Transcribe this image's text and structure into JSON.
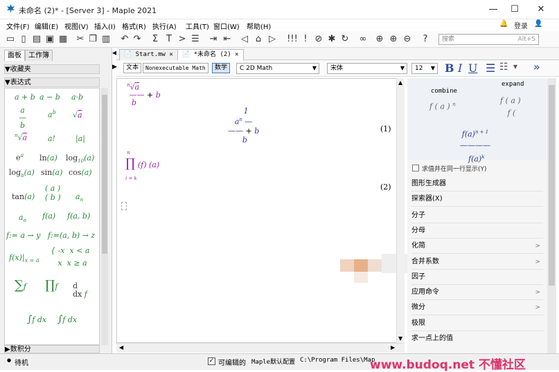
{
  "window": {
    "title": "未命名 (2)* - [Server 3] - Maple 2021",
    "minimize": "—",
    "maximize": "☐",
    "close": "✕"
  },
  "menu": {
    "items": [
      "文件(F)",
      "编辑(E)",
      "视图(V)",
      "插入(I)",
      "格式(R)",
      "执行(A)",
      "工具(T)",
      "窗口(W)",
      "帮助(H)"
    ],
    "login": "登录"
  },
  "search": {
    "placeholder": "搜索",
    "shortcut": "Alt+S"
  },
  "left_panel": {
    "tabs": [
      "面板",
      "工作簿"
    ],
    "favorites": "收藏夹",
    "expressions": "表达式",
    "bottom_section": "数积分"
  },
  "doc_tabs": [
    {
      "label": "Start.mw"
    },
    {
      "label": "*未命名 (2)"
    }
  ],
  "format_bar": {
    "text_btn": "文本",
    "nonexec_btn": "Nonexecutable Math",
    "math_btn": "数学",
    "style_select": "C 2D Math",
    "font_select": "宋体",
    "size_select": "12"
  },
  "document": {
    "labels": [
      "(1)",
      "(2)"
    ]
  },
  "right_panel": {
    "combine_label": "combine",
    "expand_label": "expand",
    "checkbox_label": "求值并在同一行显示(Y)",
    "items": [
      {
        "label": "图形生成器",
        "arrow": ""
      },
      {
        "label": "探索器(X)",
        "arrow": ""
      },
      {
        "label": "分子",
        "arrow": ""
      },
      {
        "label": "分母",
        "arrow": ""
      },
      {
        "label": "化简",
        "arrow": ">"
      },
      {
        "label": "合并系数",
        "arrow": ">"
      },
      {
        "label": "因子",
        "arrow": ""
      },
      {
        "label": "应用命令",
        "arrow": ">"
      },
      {
        "label": "微分",
        "arrow": ">"
      },
      {
        "label": "极限",
        "arrow": ""
      },
      {
        "label": "求一点上的值",
        "arrow": ""
      }
    ]
  },
  "status": {
    "state": "待机",
    "editable_label": "可编辑的",
    "config": "Maple默认配置",
    "path": "C:\\Program Files\\Map",
    "watermark": "www.budoq.net 不懂社区"
  },
  "colors": {
    "palette_green": "#2a8a3a",
    "palette_purple": "#9b1fb0",
    "math_blue": "#2a3aa0",
    "watermark": "#e0336b"
  }
}
